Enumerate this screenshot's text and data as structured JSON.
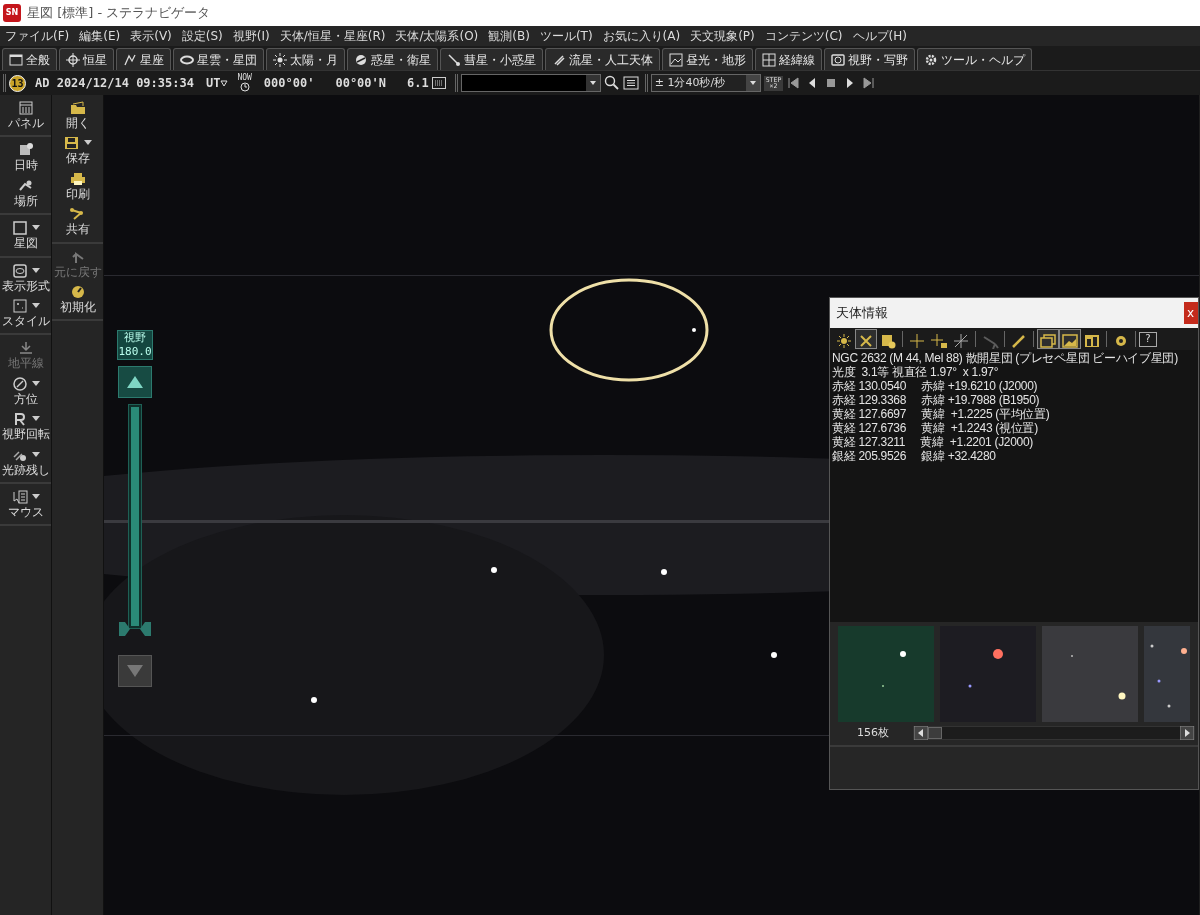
{
  "window": {
    "title": "星図 [標準] - ステラナビゲータ",
    "app_icon": "SN"
  },
  "menu": [
    "ファイル(F)",
    "編集(E)",
    "表示(V)",
    "設定(S)",
    "視野(I)",
    "天体/恒星・星座(R)",
    "天体/太陽系(O)",
    "観測(B)",
    "ツール(T)",
    "お気に入り(A)",
    "天文現象(P)",
    "コンテンツ(C)",
    "ヘルプ(H)"
  ],
  "tabs": [
    {
      "label": "全般",
      "selected": false
    },
    {
      "label": "恒星",
      "selected": false
    },
    {
      "label": "星座",
      "selected": false
    },
    {
      "label": "星雲・星団",
      "selected": false
    },
    {
      "label": "太陽・月",
      "selected": false
    },
    {
      "label": "惑星・衛星",
      "selected": false
    },
    {
      "label": "彗星・小惑星",
      "selected": false
    },
    {
      "label": "流星・人工天体",
      "selected": false
    },
    {
      "label": "昼光・地形",
      "selected": false
    },
    {
      "label": "経緯線",
      "selected": false
    },
    {
      "label": "視野・写野",
      "selected": false
    },
    {
      "label": "ツール・ヘルプ",
      "selected": false
    }
  ],
  "toolbar": {
    "moon_age": "13",
    "datetime": "AD 2024/12/14 09:35:34",
    "timezone": "UT",
    "now_label": "NOW",
    "longitude": "000°00'",
    "latitude": "00°00'N",
    "magnitude": "6.1",
    "speed": "± 1分40秒/秒",
    "step_label": "STEP",
    "step_factor": "×2"
  },
  "side_panel_left": [
    [
      {
        "label": "パネル",
        "dropdown": false,
        "disabled": false
      }
    ],
    [
      {
        "label": "日時",
        "dropdown": false,
        "disabled": false
      },
      {
        "label": "場所",
        "dropdown": false,
        "disabled": false
      }
    ],
    [
      {
        "label": "星図",
        "dropdown": true,
        "disabled": false
      }
    ],
    [
      {
        "label": "表示形式",
        "dropdown": true,
        "disabled": false
      },
      {
        "label": "スタイル",
        "dropdown": true,
        "disabled": false
      }
    ],
    [
      {
        "label": "地平線",
        "dropdown": false,
        "disabled": true
      },
      {
        "label": "方位",
        "dropdown": true,
        "disabled": false
      },
      {
        "label": "視野回転",
        "dropdown": true,
        "disabled": false
      },
      {
        "label": "光跡残し",
        "dropdown": true,
        "disabled": false
      }
    ],
    [
      {
        "label": "マウス",
        "dropdown": true,
        "disabled": false
      }
    ]
  ],
  "side_panel_right": [
    [
      {
        "label": "開く",
        "dropdown": false,
        "disabled": false
      },
      {
        "label": "保存",
        "dropdown": true,
        "disabled": false
      },
      {
        "label": "印刷",
        "dropdown": false,
        "disabled": false
      },
      {
        "label": "共有",
        "dropdown": false,
        "disabled": false
      }
    ],
    [
      {
        "label": "元に戻す",
        "dropdown": false,
        "disabled": true
      },
      {
        "label": "初期化",
        "dropdown": false,
        "disabled": false
      }
    ]
  ],
  "field_of_view": {
    "label": "視野",
    "value": "180.0",
    "level": 1
  },
  "info_window": {
    "title": "天体情報",
    "close": "x",
    "tools": [
      {
        "selected": false,
        "disabled": false
      },
      {
        "selected": true,
        "disabled": false
      },
      {
        "selected": false,
        "disabled": false
      },
      {
        "selected": false,
        "disabled": false
      },
      {
        "selected": false,
        "disabled": false
      },
      {
        "selected": false,
        "disabled": false
      },
      {
        "selected": false,
        "disabled": true
      },
      {
        "selected": false,
        "disabled": false
      },
      {
        "selected": true,
        "disabled": false
      },
      {
        "selected": true,
        "disabled": false
      },
      {
        "selected": false,
        "disabled": false
      },
      {
        "selected": false,
        "disabled": false
      }
    ],
    "help": "?",
    "lines": [
      "NGC 2632 (M 44, Mel 88) 散開星団 (プレセペ星団 ビーハイブ星団)",
      "光度  3.1等 視直径 1.97°  x 1.97°",
      "赤経 130.0540     赤緯 +19.6210 (J2000)",
      "赤経 129.3368     赤緯 +19.7988 (B1950)",
      "黄経 127.6697     黄緯  +1.2225 (平均位置)",
      "黄経 127.6736     黄緯  +1.2243 (視位置)",
      "黄経 127.3211     黄緯  +1.2201 (J2000)",
      "銀経 205.9526     銀緯 +32.4280"
    ],
    "photo_count": "156枚"
  }
}
